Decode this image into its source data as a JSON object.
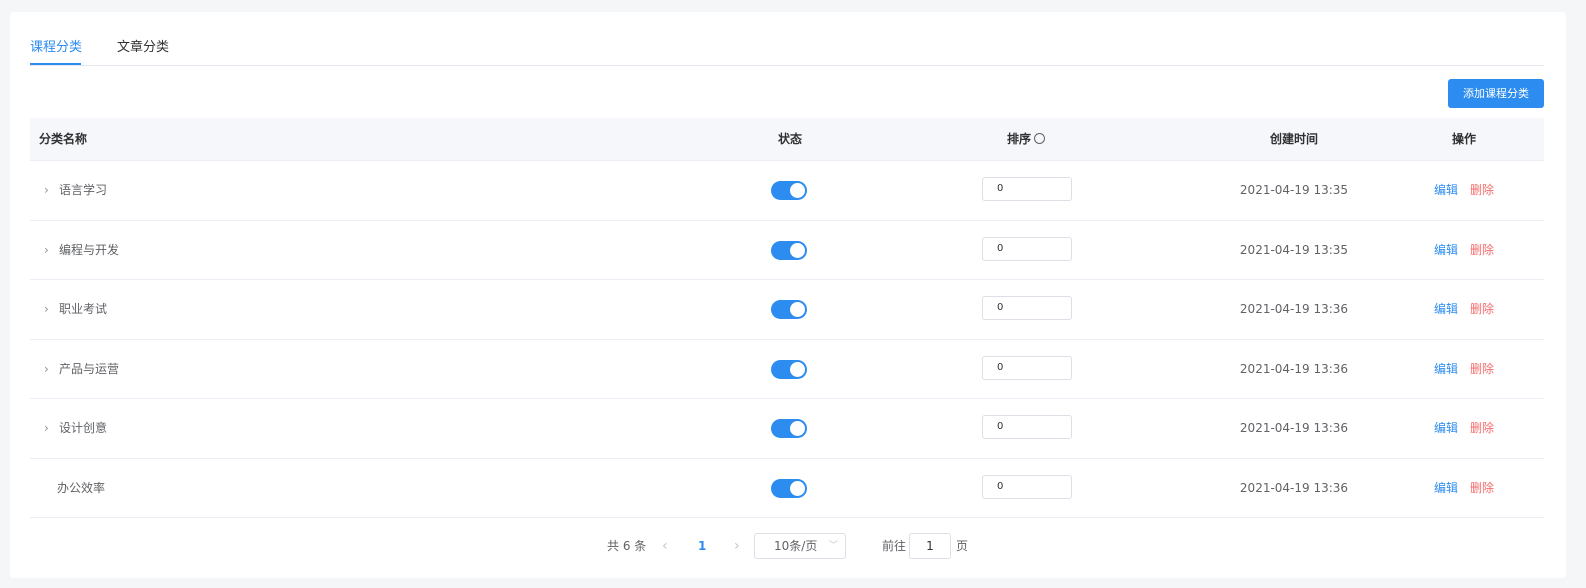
{
  "tabs": [
    {
      "label": "课程分类",
      "active": true
    },
    {
      "label": "文章分类",
      "active": false
    }
  ],
  "toolbar": {
    "add_label": "添加课程分类"
  },
  "table": {
    "headers": {
      "name": "分类名称",
      "status": "状态",
      "sort": "排序",
      "time": "创建时间",
      "ops": "操作"
    },
    "rows": [
      {
        "name": "语言学习",
        "expandable": true,
        "status": true,
        "sort": "0",
        "time": "2021-04-19 13:35",
        "edit": "编辑",
        "delete": "删除"
      },
      {
        "name": "编程与开发",
        "expandable": true,
        "status": true,
        "sort": "0",
        "time": "2021-04-19 13:35",
        "edit": "编辑",
        "delete": "删除"
      },
      {
        "name": "职业考试",
        "expandable": true,
        "status": true,
        "sort": "0",
        "time": "2021-04-19 13:36",
        "edit": "编辑",
        "delete": "删除"
      },
      {
        "name": "产品与运营",
        "expandable": true,
        "status": true,
        "sort": "0",
        "time": "2021-04-19 13:36",
        "edit": "编辑",
        "delete": "删除"
      },
      {
        "name": "设计创意",
        "expandable": true,
        "status": true,
        "sort": "0",
        "time": "2021-04-19 13:36",
        "edit": "编辑",
        "delete": "删除"
      },
      {
        "name": "办公效率",
        "expandable": false,
        "status": true,
        "sort": "0",
        "time": "2021-04-19 13:36",
        "edit": "编辑",
        "delete": "删除"
      }
    ]
  },
  "pagination": {
    "total_text": "共 6 条",
    "current_page": "1",
    "page_size": "10条/页",
    "goto_label": "前往",
    "goto_value": "1",
    "page_suffix": "页"
  },
  "colors": {
    "accent": "#2d8cf0",
    "danger": "#f56c6c",
    "header_bg": "#f5f7fa"
  },
  "icons": {
    "expand": "chevron-right-icon",
    "help": "help-circle-icon",
    "prev": "chevron-left-icon",
    "next": "chevron-right-icon",
    "dropdown": "chevron-down-icon"
  }
}
